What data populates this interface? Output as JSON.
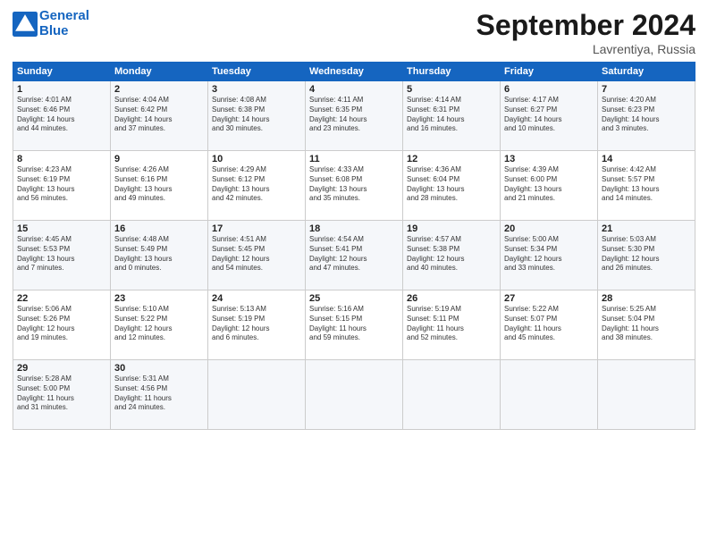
{
  "header": {
    "logo_line1": "General",
    "logo_line2": "Blue",
    "month": "September 2024",
    "location": "Lavrentiya, Russia"
  },
  "weekdays": [
    "Sunday",
    "Monday",
    "Tuesday",
    "Wednesday",
    "Thursday",
    "Friday",
    "Saturday"
  ],
  "weeks": [
    [
      {
        "day": "1",
        "lines": [
          "Sunrise: 4:01 AM",
          "Sunset: 6:46 PM",
          "Daylight: 14 hours",
          "and 44 minutes."
        ]
      },
      {
        "day": "2",
        "lines": [
          "Sunrise: 4:04 AM",
          "Sunset: 6:42 PM",
          "Daylight: 14 hours",
          "and 37 minutes."
        ]
      },
      {
        "day": "3",
        "lines": [
          "Sunrise: 4:08 AM",
          "Sunset: 6:38 PM",
          "Daylight: 14 hours",
          "and 30 minutes."
        ]
      },
      {
        "day": "4",
        "lines": [
          "Sunrise: 4:11 AM",
          "Sunset: 6:35 PM",
          "Daylight: 14 hours",
          "and 23 minutes."
        ]
      },
      {
        "day": "5",
        "lines": [
          "Sunrise: 4:14 AM",
          "Sunset: 6:31 PM",
          "Daylight: 14 hours",
          "and 16 minutes."
        ]
      },
      {
        "day": "6",
        "lines": [
          "Sunrise: 4:17 AM",
          "Sunset: 6:27 PM",
          "Daylight: 14 hours",
          "and 10 minutes."
        ]
      },
      {
        "day": "7",
        "lines": [
          "Sunrise: 4:20 AM",
          "Sunset: 6:23 PM",
          "Daylight: 14 hours",
          "and 3 minutes."
        ]
      }
    ],
    [
      {
        "day": "8",
        "lines": [
          "Sunrise: 4:23 AM",
          "Sunset: 6:19 PM",
          "Daylight: 13 hours",
          "and 56 minutes."
        ]
      },
      {
        "day": "9",
        "lines": [
          "Sunrise: 4:26 AM",
          "Sunset: 6:16 PM",
          "Daylight: 13 hours",
          "and 49 minutes."
        ]
      },
      {
        "day": "10",
        "lines": [
          "Sunrise: 4:29 AM",
          "Sunset: 6:12 PM",
          "Daylight: 13 hours",
          "and 42 minutes."
        ]
      },
      {
        "day": "11",
        "lines": [
          "Sunrise: 4:33 AM",
          "Sunset: 6:08 PM",
          "Daylight: 13 hours",
          "and 35 minutes."
        ]
      },
      {
        "day": "12",
        "lines": [
          "Sunrise: 4:36 AM",
          "Sunset: 6:04 PM",
          "Daylight: 13 hours",
          "and 28 minutes."
        ]
      },
      {
        "day": "13",
        "lines": [
          "Sunrise: 4:39 AM",
          "Sunset: 6:00 PM",
          "Daylight: 13 hours",
          "and 21 minutes."
        ]
      },
      {
        "day": "14",
        "lines": [
          "Sunrise: 4:42 AM",
          "Sunset: 5:57 PM",
          "Daylight: 13 hours",
          "and 14 minutes."
        ]
      }
    ],
    [
      {
        "day": "15",
        "lines": [
          "Sunrise: 4:45 AM",
          "Sunset: 5:53 PM",
          "Daylight: 13 hours",
          "and 7 minutes."
        ]
      },
      {
        "day": "16",
        "lines": [
          "Sunrise: 4:48 AM",
          "Sunset: 5:49 PM",
          "Daylight: 13 hours",
          "and 0 minutes."
        ]
      },
      {
        "day": "17",
        "lines": [
          "Sunrise: 4:51 AM",
          "Sunset: 5:45 PM",
          "Daylight: 12 hours",
          "and 54 minutes."
        ]
      },
      {
        "day": "18",
        "lines": [
          "Sunrise: 4:54 AM",
          "Sunset: 5:41 PM",
          "Daylight: 12 hours",
          "and 47 minutes."
        ]
      },
      {
        "day": "19",
        "lines": [
          "Sunrise: 4:57 AM",
          "Sunset: 5:38 PM",
          "Daylight: 12 hours",
          "and 40 minutes."
        ]
      },
      {
        "day": "20",
        "lines": [
          "Sunrise: 5:00 AM",
          "Sunset: 5:34 PM",
          "Daylight: 12 hours",
          "and 33 minutes."
        ]
      },
      {
        "day": "21",
        "lines": [
          "Sunrise: 5:03 AM",
          "Sunset: 5:30 PM",
          "Daylight: 12 hours",
          "and 26 minutes."
        ]
      }
    ],
    [
      {
        "day": "22",
        "lines": [
          "Sunrise: 5:06 AM",
          "Sunset: 5:26 PM",
          "Daylight: 12 hours",
          "and 19 minutes."
        ]
      },
      {
        "day": "23",
        "lines": [
          "Sunrise: 5:10 AM",
          "Sunset: 5:22 PM",
          "Daylight: 12 hours",
          "and 12 minutes."
        ]
      },
      {
        "day": "24",
        "lines": [
          "Sunrise: 5:13 AM",
          "Sunset: 5:19 PM",
          "Daylight: 12 hours",
          "and 6 minutes."
        ]
      },
      {
        "day": "25",
        "lines": [
          "Sunrise: 5:16 AM",
          "Sunset: 5:15 PM",
          "Daylight: 11 hours",
          "and 59 minutes."
        ]
      },
      {
        "day": "26",
        "lines": [
          "Sunrise: 5:19 AM",
          "Sunset: 5:11 PM",
          "Daylight: 11 hours",
          "and 52 minutes."
        ]
      },
      {
        "day": "27",
        "lines": [
          "Sunrise: 5:22 AM",
          "Sunset: 5:07 PM",
          "Daylight: 11 hours",
          "and 45 minutes."
        ]
      },
      {
        "day": "28",
        "lines": [
          "Sunrise: 5:25 AM",
          "Sunset: 5:04 PM",
          "Daylight: 11 hours",
          "and 38 minutes."
        ]
      }
    ],
    [
      {
        "day": "29",
        "lines": [
          "Sunrise: 5:28 AM",
          "Sunset: 5:00 PM",
          "Daylight: 11 hours",
          "and 31 minutes."
        ]
      },
      {
        "day": "30",
        "lines": [
          "Sunrise: 5:31 AM",
          "Sunset: 4:56 PM",
          "Daylight: 11 hours",
          "and 24 minutes."
        ]
      },
      {
        "day": "",
        "lines": []
      },
      {
        "day": "",
        "lines": []
      },
      {
        "day": "",
        "lines": []
      },
      {
        "day": "",
        "lines": []
      },
      {
        "day": "",
        "lines": []
      }
    ]
  ]
}
